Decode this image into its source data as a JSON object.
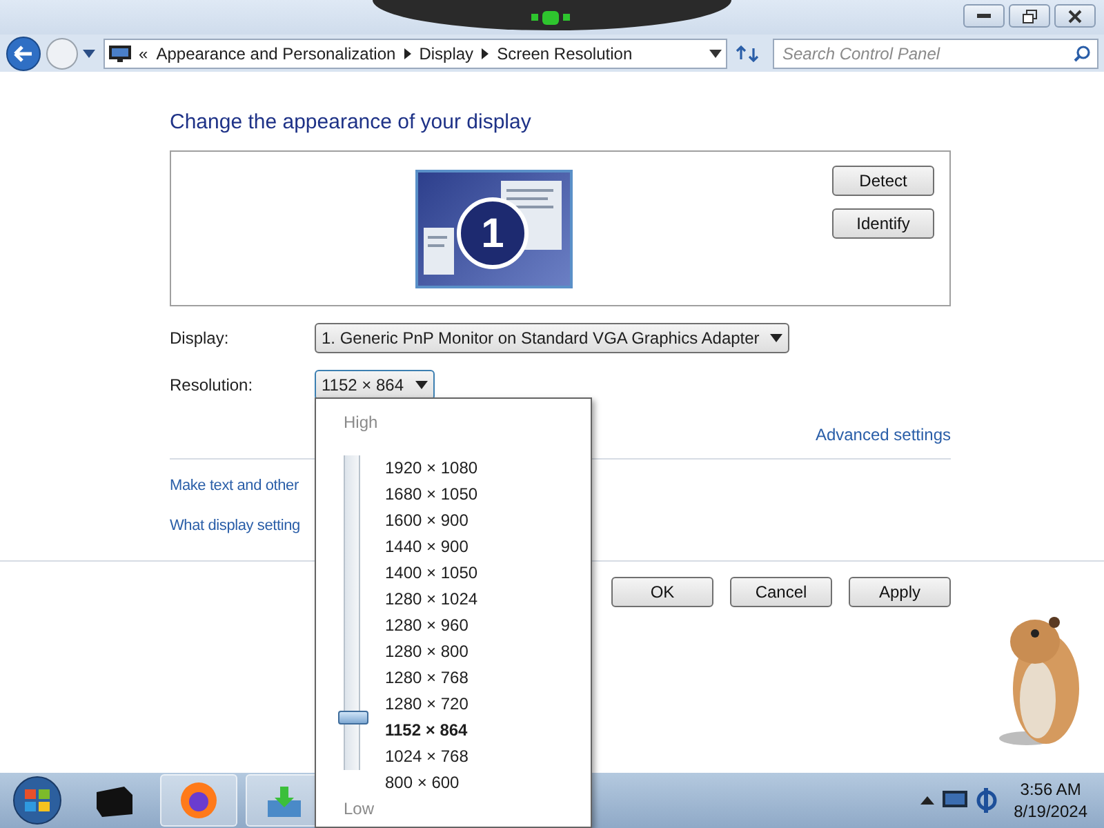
{
  "address_bar": {
    "overflow": "«",
    "breadcrumbs": [
      "Appearance and Personalization",
      "Display",
      "Screen Resolution"
    ]
  },
  "search": {
    "placeholder": "Search Control Panel"
  },
  "heading": "Change the appearance of your display",
  "preview": {
    "monitor_number": "1",
    "buttons": [
      "Detect",
      "Identify"
    ]
  },
  "fields": [
    {
      "label": "Display:",
      "value": "1. Generic PnP Monitor on Standard VGA Graphics Adapter"
    },
    {
      "label": "Resolution:",
      "value": "1152 × 864",
      "expanded": true
    }
  ],
  "advanced_link": "Advanced settings",
  "links": [
    "Make text and other",
    "What display setting"
  ],
  "dialog_buttons": [
    "OK",
    "Cancel",
    "Apply"
  ],
  "resolution_popup": {
    "high": "High",
    "low": "Low",
    "level": 0.17,
    "options": [
      {
        "label": "1920 × 1080",
        "selected": false
      },
      {
        "label": "1680 × 1050",
        "selected": false
      },
      {
        "label": "1600 × 900",
        "selected": false
      },
      {
        "label": "1440 × 900",
        "selected": false
      },
      {
        "label": "1400 × 1050",
        "selected": false
      },
      {
        "label": "1280 × 1024",
        "selected": false
      },
      {
        "label": "1280 × 960",
        "selected": false
      },
      {
        "label": "1280 × 800",
        "selected": false
      },
      {
        "label": "1280 × 768",
        "selected": false
      },
      {
        "label": "1280 × 720",
        "selected": false
      },
      {
        "label": "1152 × 864",
        "selected": true
      },
      {
        "label": "1024 × 768",
        "selected": false
      },
      {
        "label": "800 × 600",
        "selected": false
      }
    ]
  },
  "taskbar": {
    "time": "3:56 AM",
    "date": "8/19/2024"
  }
}
